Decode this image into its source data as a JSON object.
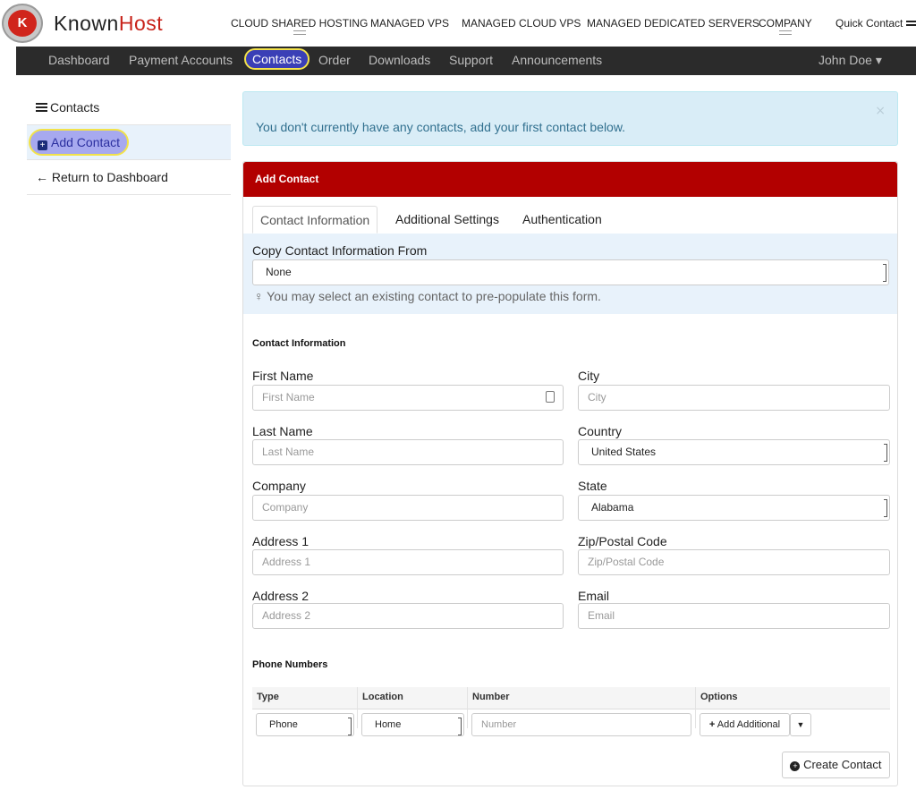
{
  "brand": {
    "logo_text": "K",
    "known": "Known",
    "host": "Host"
  },
  "top_nav": [
    "CLOUD SHARED HOSTING",
    "MANAGED VPS",
    "MANAGED CLOUD VPS",
    "MANAGED DEDICATED SERVERS",
    "COMPANY"
  ],
  "quick_contact": "Quick Contact",
  "main_nav": [
    "Dashboard",
    "Payment Accounts",
    "Contacts",
    "Order",
    "Downloads",
    "Support",
    "Announcements"
  ],
  "user_menu": "John Doe ▾",
  "sidebar": {
    "items": [
      {
        "label": "Contacts"
      },
      {
        "label": "Add Contact"
      },
      {
        "label": "Return to Dashboard"
      }
    ]
  },
  "alert": {
    "text": "You don't currently have any contacts, add your first contact below.",
    "close": "×"
  },
  "panel": {
    "title": "Add Contact",
    "tabs": [
      "Contact Information",
      "Additional Settings",
      "Authentication"
    ]
  },
  "copy": {
    "label": "Copy Contact Information From",
    "value": "None",
    "hint": "You may select an existing contact to pre-populate this form."
  },
  "contact_info": {
    "title": "Contact Information",
    "first_name": {
      "label": "First Name",
      "placeholder": "First Name"
    },
    "last_name": {
      "label": "Last Name",
      "placeholder": "Last Name"
    },
    "company": {
      "label": "Company",
      "placeholder": "Company"
    },
    "address1": {
      "label": "Address 1",
      "placeholder": "Address 1"
    },
    "address2": {
      "label": "Address 2",
      "placeholder": "Address 2"
    },
    "city": {
      "label": "City",
      "placeholder": "City"
    },
    "country": {
      "label": "Country",
      "value": "United States"
    },
    "state": {
      "label": "State",
      "value": "Alabama"
    },
    "zip": {
      "label": "Zip/Postal Code",
      "placeholder": "Zip/Postal Code"
    },
    "email": {
      "label": "Email",
      "placeholder": "Email"
    }
  },
  "phones": {
    "title": "Phone Numbers",
    "headers": [
      "Type",
      "Location",
      "Number",
      "Options"
    ],
    "type": "Phone",
    "location": "Home",
    "number_placeholder": "Number",
    "add_label": "Add Additional"
  },
  "create_label": "Create Contact",
  "colors": {
    "accent": "#b20000",
    "nav_bg": "#2b2b2b",
    "highlight": "#f3e24a",
    "info_bg": "#d9edf7"
  }
}
